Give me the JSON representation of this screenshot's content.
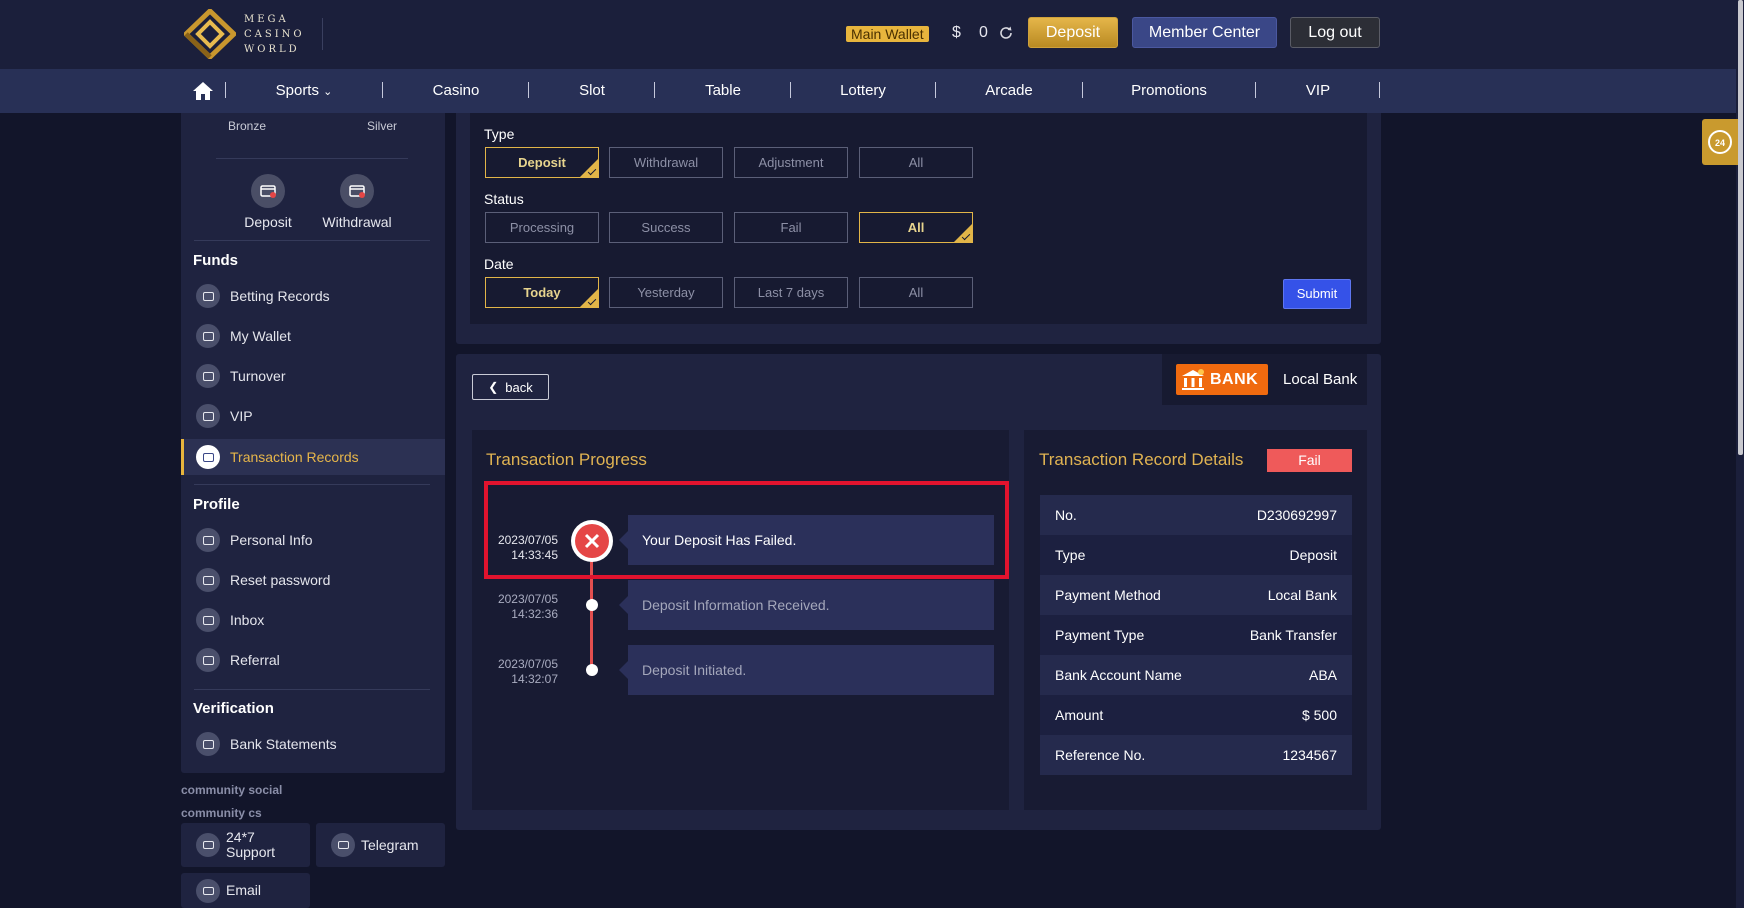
{
  "brand": {
    "line1": "MEGA",
    "line2": "CASINO",
    "line3": "WORLD"
  },
  "header": {
    "wallet_label": "Main Wallet",
    "currency": "$",
    "balance": "0",
    "deposit_label": "Deposit",
    "member_label": "Member Center",
    "logout_label": "Log out"
  },
  "nav": [
    "Sports",
    "Casino",
    "Slot",
    "Table",
    "Lottery",
    "Arcade",
    "Promotions",
    "VIP"
  ],
  "sidebar": {
    "tiers": [
      "Bronze",
      "Silver"
    ],
    "quick": [
      "Deposit",
      "Withdrawal"
    ],
    "funds_title": "Funds",
    "funds": [
      "Betting Records",
      "My Wallet",
      "Turnover",
      "VIP",
      "Transaction Records"
    ],
    "profile_title": "Profile",
    "profile": [
      "Personal Info",
      "Reset password",
      "Inbox",
      "Referral"
    ],
    "verification_title": "Verification",
    "verification": [
      "Bank Statements"
    ],
    "community_social": "community social",
    "community_cs": "community cs",
    "cs_support_1": "24*7",
    "cs_support_2": "Support",
    "cs_telegram": "Telegram",
    "cs_email": "Email"
  },
  "filters": {
    "type_label": "Type",
    "type_options": [
      "Deposit",
      "Withdrawal",
      "Adjustment",
      "All"
    ],
    "status_label": "Status",
    "status_options": [
      "Processing",
      "Success",
      "Fail",
      "All"
    ],
    "date_label": "Date",
    "date_options": [
      "Today",
      "Yesterday",
      "Last 7 days",
      "All"
    ],
    "submit_label": "Submit"
  },
  "detail": {
    "back_label": "back",
    "bank_logo_text": "BANK",
    "bank_name": "Local Bank",
    "progress_title": "Transaction Progress",
    "record_title": "Transaction Record Details",
    "status_badge": "Fail",
    "timeline": [
      {
        "date": "2023/07/05",
        "time": "14:33:45",
        "text": "Your Deposit Has Failed."
      },
      {
        "date": "2023/07/05",
        "time": "14:32:36",
        "text": "Deposit Information Received."
      },
      {
        "date": "2023/07/05",
        "time": "14:32:07",
        "text": "Deposit Initiated."
      }
    ],
    "records": [
      {
        "label": "No.",
        "value": "D230692997"
      },
      {
        "label": "Type",
        "value": "Deposit"
      },
      {
        "label": "Payment Method",
        "value": "Local Bank"
      },
      {
        "label": "Payment Type",
        "value": "Bank Transfer"
      },
      {
        "label": "Bank Account Name",
        "value": "ABA"
      },
      {
        "label": "Amount",
        "value": "$ 500"
      },
      {
        "label": "Reference No.",
        "value": "1234567"
      }
    ]
  },
  "colors": {
    "accent": "#e8b53d",
    "fail": "#e54646",
    "primary": "#3552e8",
    "nav": "#283056"
  }
}
